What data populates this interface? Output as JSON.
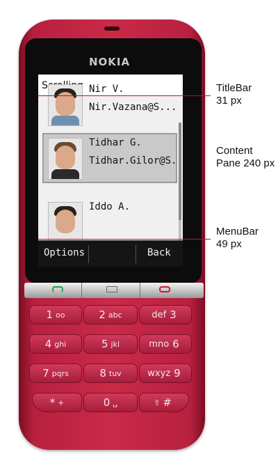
{
  "screen": {
    "brand": "NOKIA",
    "title": "Scrolling",
    "contacts": [
      {
        "name": "Nir V.",
        "email": "Nir.Vazana@S...",
        "selected": false
      },
      {
        "name": "Tidhar G.",
        "email": "Tidhar.Gilor@S...",
        "selected": true
      },
      {
        "name": "Iddo A.",
        "email": "",
        "selected": false
      }
    ],
    "menubar": {
      "left": "Options",
      "right": "Back"
    }
  },
  "softkeys": {
    "icons": [
      "call-green-icon",
      "message-icon",
      "end-call-red-icon"
    ]
  },
  "keypad": {
    "keys": [
      {
        "main": "1",
        "sub": "oo"
      },
      {
        "main": "2",
        "sub": "abc"
      },
      {
        "main": "def",
        "sub": "3"
      },
      {
        "main": "4",
        "sub": "ghi"
      },
      {
        "main": "5",
        "sub": "jkl"
      },
      {
        "main": "mno",
        "sub": "6"
      },
      {
        "main": "7",
        "sub": "pqrs"
      },
      {
        "main": "8",
        "sub": "tuv"
      },
      {
        "main": "wxyz",
        "sub": "9"
      },
      {
        "main": "*",
        "sub": "+"
      },
      {
        "main": "0",
        "sub": "␣"
      },
      {
        "main": "⇧",
        "sub": "#"
      }
    ]
  },
  "annotations": {
    "titlebar": {
      "line1": "TitleBar",
      "line2": "31 px"
    },
    "content": {
      "line1": "Content",
      "line2": "Pane 240 px"
    },
    "menubar": {
      "line1": "MenuBar",
      "line2": "49 px"
    }
  },
  "colors": {
    "phone_body": "#c92a48",
    "callout_line": "#c0102c",
    "selection": "#c9c9c9"
  }
}
